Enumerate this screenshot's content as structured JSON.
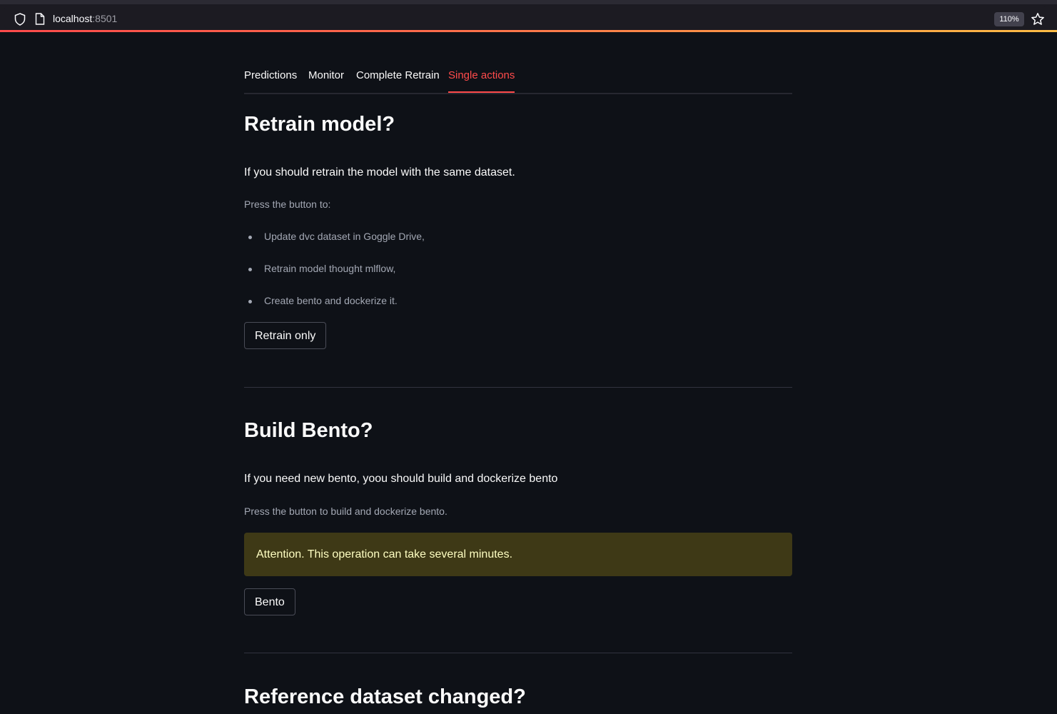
{
  "browser": {
    "url_host": "localhost",
    "url_port": ":8501",
    "zoom": "110%"
  },
  "tabs": [
    {
      "label": "Predictions"
    },
    {
      "label": "Monitor"
    },
    {
      "label": "Complete Retrain"
    },
    {
      "label": "Single actions"
    }
  ],
  "active_tab": "Single actions",
  "sections": {
    "retrain": {
      "title": "Retrain model?",
      "lead": "If you should retrain the model with the same dataset.",
      "intro": "Press the button to:",
      "bullets": [
        "Update dvc dataset in Goggle Drive,",
        "Retrain model thought mlflow,",
        "Create bento and dockerize it."
      ],
      "button": "Retrain only"
    },
    "bento": {
      "title": "Build Bento?",
      "lead": "If you need new bento, yoou should build and dockerize bento",
      "intro": "Press the button to build and dockerize bento.",
      "warning": "Attention. This operation can take several minutes.",
      "button": "Bento"
    },
    "reference": {
      "title": "Reference dataset changed?"
    }
  },
  "colors": {
    "background": "#0e1117",
    "accent": "#ff4b4b",
    "warning_bg": "#3e3916",
    "warning_text": "#ffffc2"
  }
}
